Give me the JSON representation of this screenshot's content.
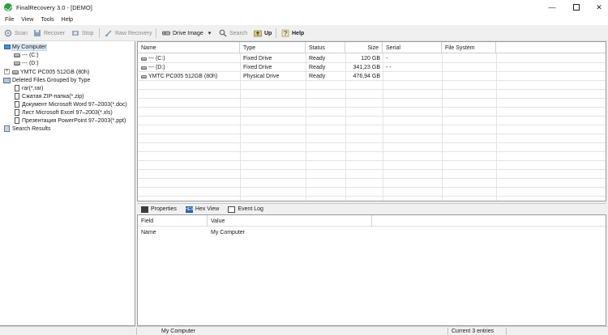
{
  "window": {
    "title": "FinalRecovery 3.0 - [DEMO]",
    "controls": {
      "minimize": "—",
      "close": "✕"
    }
  },
  "menu": [
    "File",
    "View",
    "Tools",
    "Help"
  ],
  "toolbar": {
    "scan": "Scan",
    "recover": "Recover",
    "stop": "Stop",
    "raw_recovery": "Raw Recovery",
    "drive_image": "Drive Image",
    "drive_image_arrow": "▾",
    "search": "Search",
    "up": "Up",
    "help": "Help"
  },
  "tree": {
    "root": "My Computer",
    "drives": [
      "--- (C:)",
      "--- (D:)"
    ],
    "physical": "YMTC PC005 512GB (80h)",
    "deleted_group": "Deleted Files Grouped by Type",
    "deleted_types": [
      "rar(*.rar)",
      "Сжатая ZIP-папка(*.zip)",
      "Документ Microsoft Word 97–2003(*.doc)",
      "Лист Microsoft Excel 97–2003(*.xls)",
      "Презентация PowerPoint 97–2003(*.ppt)"
    ],
    "search_results": "Search Results",
    "expander_minus": "−",
    "expander_plus": "+"
  },
  "grid": {
    "columns": [
      "Name",
      "Type",
      "Status",
      "Size",
      "Serial",
      "File System"
    ],
    "rows": [
      {
        "name": "--- (C:)",
        "type": "Fixed Drive",
        "status": "Ready",
        "size": "120 GB",
        "serial": "-",
        "fs": ""
      },
      {
        "name": "--- (D:)",
        "type": "Fixed Drive",
        "status": "Ready",
        "size": "341,23 GB",
        "serial": "- -",
        "fs": ""
      },
      {
        "name": "YMTC PC005 512GB (80h)",
        "type": "Physical Drive",
        "status": "Ready",
        "size": "476,94 GB",
        "serial": "",
        "fs": ""
      }
    ]
  },
  "bottom_tabs": {
    "properties": "Properties",
    "hex_view": "Hex View",
    "hex_icon": "HEX",
    "event_log": "Event Log"
  },
  "properties": {
    "columns": [
      "Field",
      "Value"
    ],
    "rows": [
      {
        "field": "Name",
        "value": "My Computer"
      }
    ]
  },
  "status": {
    "selected": "My Computer",
    "entries": "Current 3 entries"
  }
}
